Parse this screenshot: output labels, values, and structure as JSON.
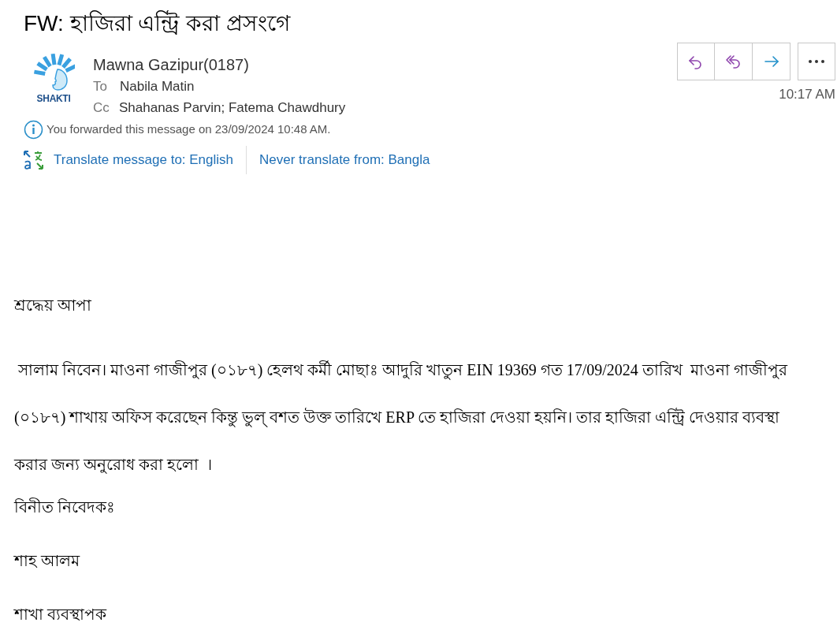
{
  "subject": "FW: হাজিরা এন্ট্রি করা প্রসংগে",
  "sender": {
    "logo_text": "SHAKTI",
    "name": "Mawna Gazipur(0187)",
    "to_label": "To",
    "to": "Nabila Matin",
    "cc_label": "Cc",
    "cc": "Shahanas Parvin; Fatema Chawdhury"
  },
  "actions": [
    {
      "kind": "reply"
    },
    {
      "kind": "reply_all"
    },
    {
      "kind": "forward"
    },
    {
      "kind": "more"
    }
  ],
  "time": "10:17 AM",
  "info": "You forwarded this message on 23/09/2024 10:48 AM.",
  "translate": {
    "translate_link": "Translate message to: English",
    "never_link": "Never translate from: Bangla"
  },
  "body": [
    "শ্রদ্ধেয় আপা",
    " সালাম নিবেন। মাওনা গাজীপুর (০১৮৭) হেলথ কর্মী মোছাঃ আদুরি খাতুন EIN 19369 গত 17/09/2024 তারিখ  মাওনা গাজীপুর (০১৮৭) শাখায় অফিস করেছেন কিন্তু ভুল্ বশত উক্ত তারিখে ERP তে হাজিরা দেওয়া হয়নি। তার হাজিরা এন্ট্রি দেওয়ার ব্যবস্থা করার জন্য অনুরোধ করা হলো  ।",
    "বিনীত নিবেদকঃ",
    "শাহ আলম",
    "শাখা ব্যবস্থাপক"
  ]
}
